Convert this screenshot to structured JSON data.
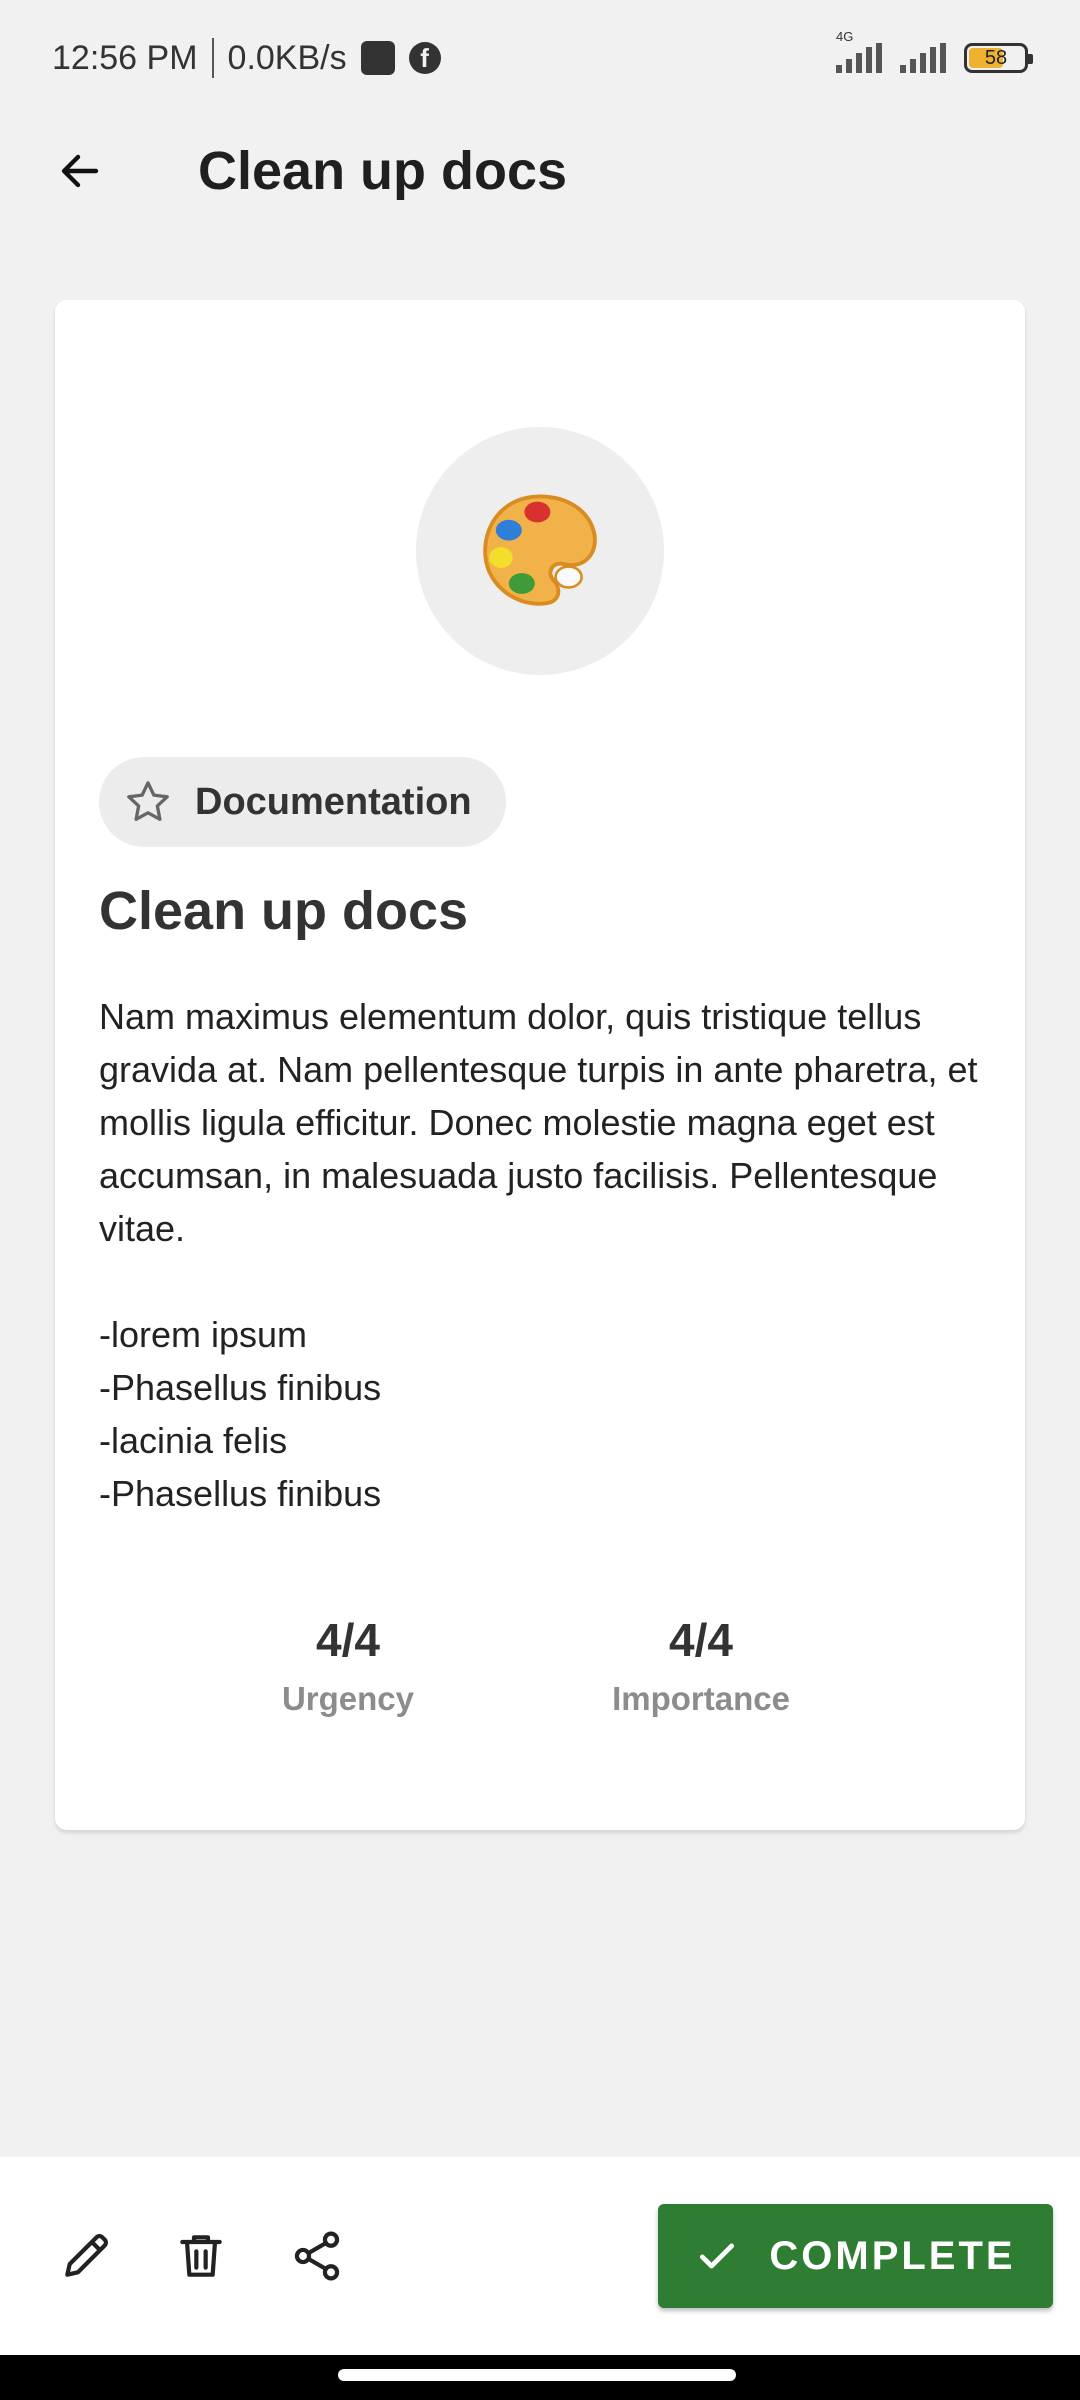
{
  "status_bar": {
    "time": "12:56 PM",
    "speed": "0.0KB/s",
    "network_label": "4G",
    "battery": "58"
  },
  "app_bar": {
    "title": "Clean up docs",
    "back_icon": "arrow-left-icon"
  },
  "task": {
    "icon": "palette-icon",
    "category": "Documentation",
    "category_icon": "star-outline-icon",
    "title": "Clean up docs",
    "description": "Nam maximus elementum dolor, quis tristique tellus gravida at. Nam pellentesque turpis in ante pharetra, et mollis ligula efficitur. Donec molestie magna eget est accumsan, in malesuada justo facilisis. Pellentesque vitae.\n\n-lorem ipsum\n-Phasellus finibus\n-lacinia felis\n-Phasellus finibus",
    "urgency": {
      "value": "4/4",
      "label": "Urgency"
    },
    "importance": {
      "value": "4/4",
      "label": "Importance"
    }
  },
  "toolbar": {
    "edit_icon": "pencil-icon",
    "delete_icon": "trash-icon",
    "share_icon": "share-icon",
    "complete_label": "COMPLETE",
    "complete_color": "#2e7d32"
  }
}
